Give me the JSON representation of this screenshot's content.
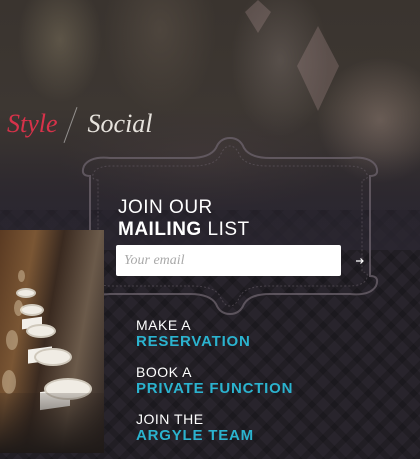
{
  "tabs": {
    "style": "Style",
    "social": "Social"
  },
  "mailing": {
    "heading_line1": "JOIN OUR",
    "heading_line2_bold": "MAILING",
    "heading_line2_rest": " LIST",
    "email_placeholder": "Your email",
    "submit_icon": "arrow-right-icon"
  },
  "actions": [
    {
      "top": "MAKE A",
      "bottom": "RESERVATION"
    },
    {
      "top": "BOOK A",
      "bottom": "PRIVATE FUNCTION"
    },
    {
      "top": "JOIN THE",
      "bottom": "ARGYLE TEAM"
    }
  ],
  "colors": {
    "accent_red": "#d8324a",
    "accent_teal": "#2bb3cf",
    "background": "#2a2630"
  }
}
